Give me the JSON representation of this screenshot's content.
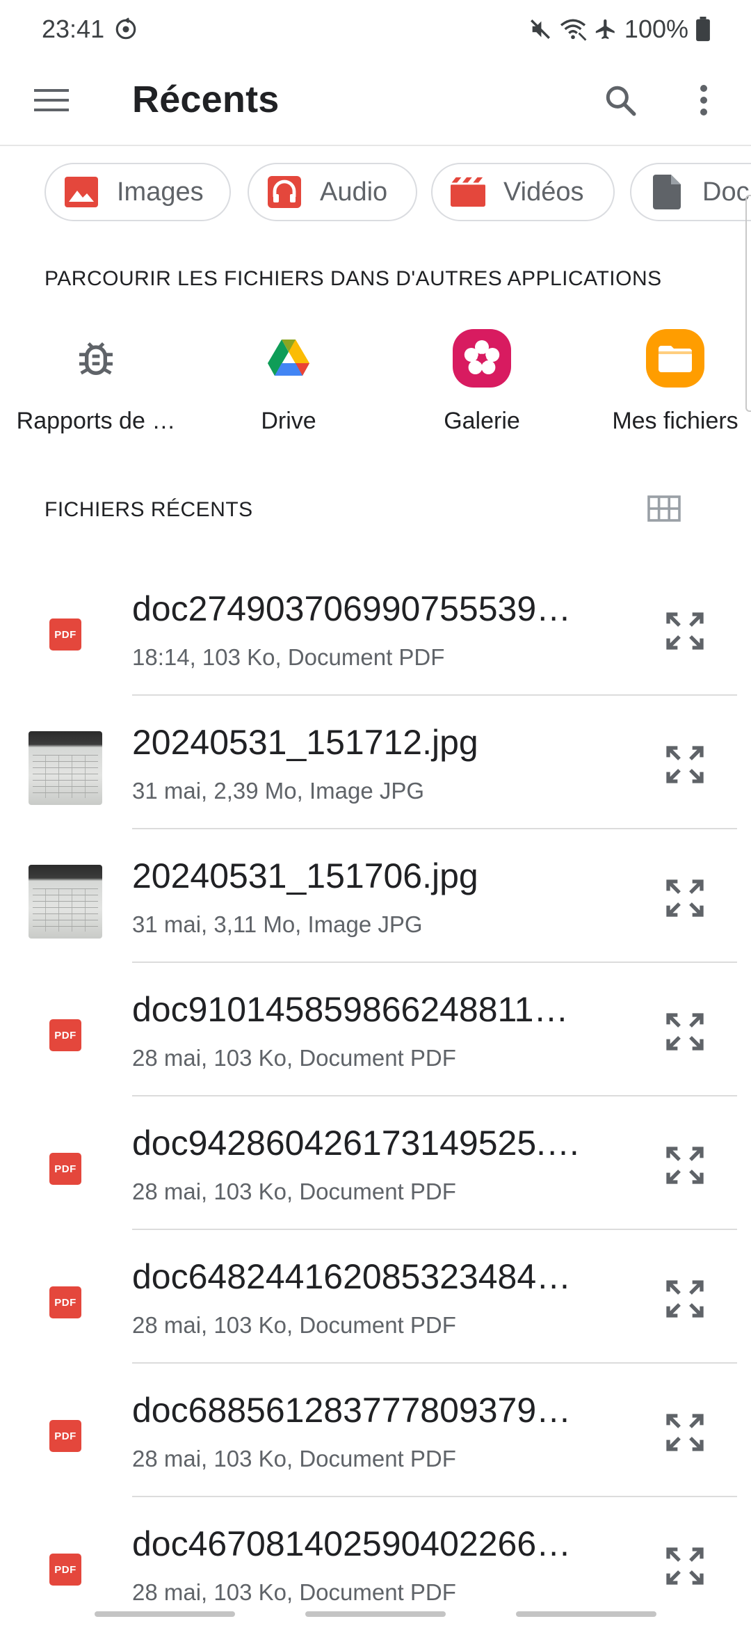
{
  "status_bar": {
    "time": "23:41",
    "battery": "100%",
    "icons": [
      "sync-icon",
      "mute-icon",
      "wifi-icon",
      "airplane-icon",
      "battery-icon"
    ]
  },
  "app_bar": {
    "title": "Récents",
    "icons": [
      "menu-icon",
      "search-icon",
      "more-vert-icon"
    ]
  },
  "chips": [
    {
      "label": "Images",
      "icon": "image-icon",
      "color": "#e4473c"
    },
    {
      "label": "Audio",
      "icon": "headphones-icon",
      "color": "#e4473c"
    },
    {
      "label": "Vidéos",
      "icon": "clapperboard-icon",
      "color": "#e4473c"
    },
    {
      "label": "Doc",
      "icon": "document-icon",
      "color": "#5f6368"
    }
  ],
  "browse_section": {
    "title": "PARCOURIR LES FICHIERS DANS D'AUTRES APPLICATIONS",
    "apps": [
      {
        "label": "Rapports de …",
        "icon": "bug-icon"
      },
      {
        "label": "Drive",
        "icon": "google-drive-icon"
      },
      {
        "label": "Galerie",
        "icon": "gallery-flower-icon",
        "color": "#d81b60"
      },
      {
        "label": "Mes fichiers",
        "icon": "folder-icon",
        "color": "#ff9d00"
      }
    ]
  },
  "recent_section": {
    "title": "FICHIERS RÉCENTS",
    "view_toggle_icon": "grid-view-icon"
  },
  "files": [
    {
      "name": "doc274903706990755539…",
      "meta": "18:14, 103 Ko, Document PDF",
      "type": "pdf",
      "badge": "PDF"
    },
    {
      "name": "20240531_151712.jpg",
      "meta": "31 mai, 2,39 Mo, Image JPG",
      "type": "image"
    },
    {
      "name": "20240531_151706.jpg",
      "meta": "31 mai, 3,11 Mo, Image JPG",
      "type": "image"
    },
    {
      "name": "doc910145859866248811…",
      "meta": "28 mai, 103 Ko, Document PDF",
      "type": "pdf",
      "badge": "PDF"
    },
    {
      "name": "doc942860426173149525.…",
      "meta": "28 mai, 103 Ko, Document PDF",
      "type": "pdf",
      "badge": "PDF"
    },
    {
      "name": "doc648244162085323484…",
      "meta": "28 mai, 103 Ko, Document PDF",
      "type": "pdf",
      "badge": "PDF"
    },
    {
      "name": "doc688561283777809379…",
      "meta": "28 mai, 103 Ko, Document PDF",
      "type": "pdf",
      "badge": "PDF"
    },
    {
      "name": "doc467081402590402266…",
      "meta": "28 mai, 103 Ko, Document PDF",
      "type": "pdf",
      "badge": "PDF"
    }
  ]
}
